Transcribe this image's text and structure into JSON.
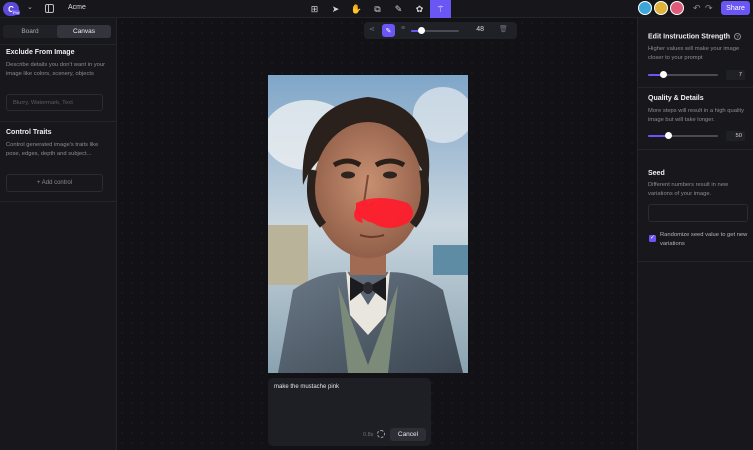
{
  "header": {
    "logo_text": "C",
    "logo_badge": "Pro",
    "project_name": "Acme",
    "tools": [
      {
        "name": "image-add-icon",
        "glyph": "⊞"
      },
      {
        "name": "select-cursor-icon",
        "glyph": "➤"
      },
      {
        "name": "hand-icon",
        "glyph": "✋"
      },
      {
        "name": "crop-frame-icon",
        "glyph": "⧉"
      },
      {
        "name": "pencil-icon",
        "glyph": "✎"
      },
      {
        "name": "palette-icon",
        "glyph": "✿"
      },
      {
        "name": "magic-wand-icon",
        "glyph": "⚚"
      }
    ],
    "avatar_colors": [
      "#3aa7d8",
      "#e0b23a",
      "#e05a7a"
    ],
    "share_label": "Share"
  },
  "left_panel": {
    "tabs": [
      "Board",
      "Canvas"
    ],
    "selected_tab": "Canvas",
    "exclude_title": "Exclude From Image",
    "exclude_desc": "Describe details you don't want in your image like colors, scenery, objects",
    "exclude_placeholder": "Blurry, Watermark, Text",
    "control_title": "Control Traits",
    "control_desc": "Control generated image's traits like pose, edges, depth and subject...",
    "add_control_label": "+ Add control"
  },
  "canvas": {
    "brush_size": "48",
    "brush_fraction": 0.2,
    "prompt_text": "make the mustache pink",
    "timer": "0.8s",
    "cancel_label": "Cancel"
  },
  "right_panel": {
    "strength_title": "Edit Instruction Strength",
    "strength_desc": "Higher values will make your image closer to your prompt",
    "strength_value": "7",
    "strength_fraction": 0.22,
    "quality_title": "Quality & Details",
    "quality_desc": "More steps will result in a high quality image but will take longer.",
    "quality_value": "50",
    "quality_fraction": 0.28,
    "seed_title": "Seed",
    "seed_desc": "Different numbers result in new variations of your image.",
    "randomize_label": "Randomize seed value to get new variations",
    "randomize_checked": true
  },
  "colors": {
    "accent": "#6a55f5",
    "mask": "#ff1e2d"
  }
}
